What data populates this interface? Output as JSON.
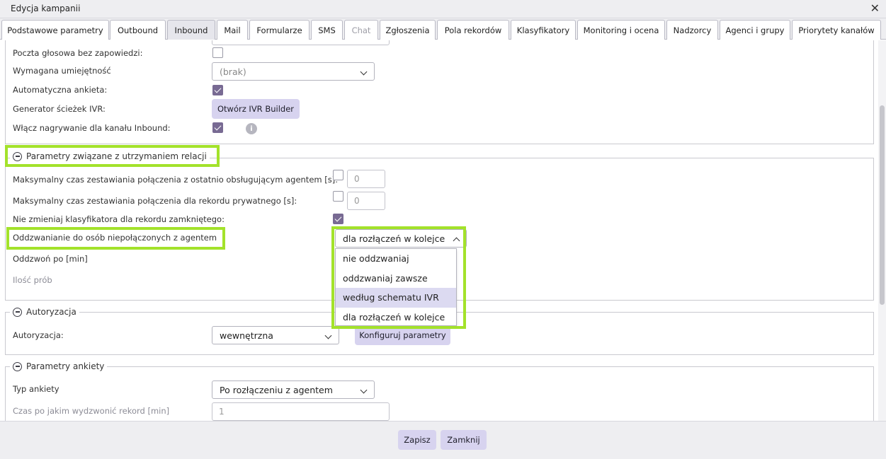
{
  "window": {
    "title": "Edycja kampanii"
  },
  "tabs": [
    {
      "label": "Podstawowe parametry"
    },
    {
      "label": "Outbound"
    },
    {
      "label": "Inbound"
    },
    {
      "label": "Mail"
    },
    {
      "label": "Formularze"
    },
    {
      "label": "SMS"
    },
    {
      "label": "Chat"
    },
    {
      "label": "Zgłoszenia"
    },
    {
      "label": "Pola rekordów"
    },
    {
      "label": "Klasyfikatory"
    },
    {
      "label": "Monitoring i ocena"
    },
    {
      "label": "Nadzorcy"
    },
    {
      "label": "Agenci i grupy"
    },
    {
      "label": "Priorytety kanałów"
    }
  ],
  "active_tab": "Inbound",
  "disabled_tab": "Chat",
  "inbound": {
    "voicemail_label": "Poczta głosowa bez zapowiedzi:",
    "voicemail_checked": false,
    "skill_label": "Wymagana umiejętność",
    "skill_value": "(brak)",
    "auto_survey_label": "Automatyczna ankieta:",
    "auto_survey_checked": true,
    "ivr_label": "Generator ścieżek IVR:",
    "ivr_button": "Otwórz IVR Builder",
    "recording_label": "Włącz nagrywanie dla kanału Inbound:",
    "recording_checked": true,
    "info_glyph": "i"
  },
  "relations": {
    "legend": "Parametry związane z utrzymaniem relacji",
    "max_last_agent_label": "Maksymalny czas zestawiania połączenia z ostatnio obsługującym agentem [s]:",
    "max_last_agent_checked": false,
    "max_last_agent_value": "0",
    "max_private_label": "Maksymalny czas zestawiania połączenia dla rekordu prywatnego [s]:",
    "max_private_checked": false,
    "max_private_value": "0",
    "no_change_classifier_label": "Nie zmieniaj klasyfikatora dla rekordu zamkniętego:",
    "no_change_classifier_checked": true,
    "callback_label": "Oddzwanianie do osób niepołączonych z agentem",
    "callback_value": "dla rozłączeń w kolejce",
    "callback_options": [
      "nie oddzwaniaj",
      "oddzwaniaj zawsze",
      "według schematu IVR",
      "dla rozłączeń w kolejce"
    ],
    "callback_hover_option": "według schematu IVR",
    "callback_after_label": "Oddzwoń po [min]",
    "attempts_label": "Ilość prób"
  },
  "authorization": {
    "legend": "Autoryzacja",
    "label": "Autoryzacja:",
    "value": "wewnętrzna",
    "configure_button": "Konfiguruj parametry"
  },
  "survey": {
    "legend": "Parametry ankiety",
    "type_label": "Typ ankiety",
    "type_value": "Po rozłączeniu z agentem",
    "call_time_label": "Czas po jakim wydzwonić rekord [min]",
    "call_time_value": "1"
  },
  "footer": {
    "save_button": "Zapisz",
    "close_button": "Zamknij"
  },
  "colors": {
    "checkbox_checked": "#786a93",
    "button_bg": "#d7d3ef",
    "highlight": "#a3e22b",
    "option_hover": "#dcdaf1"
  },
  "icons": {
    "close": "close-icon",
    "collapse": "minus-circle-icon",
    "dropdown": "chevron-down-icon",
    "dropdown_open": "chevron-up-icon",
    "info": "info-icon"
  }
}
